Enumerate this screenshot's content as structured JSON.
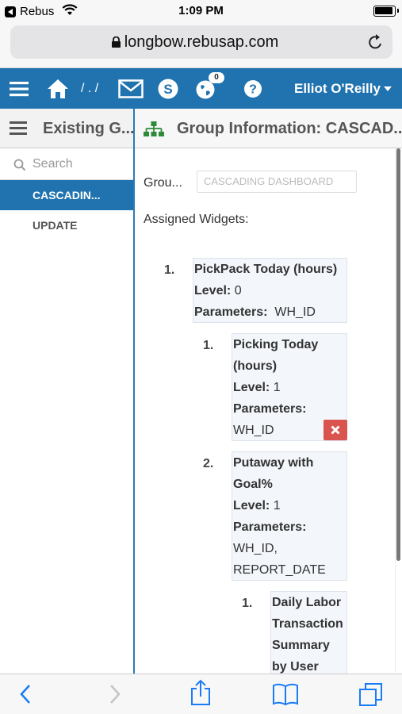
{
  "status_bar": {
    "back_app": "Rebus",
    "time": "1:09 PM"
  },
  "browser": {
    "url": "longbow.rebusap.com"
  },
  "app_header": {
    "breadcrumb": "/ . /",
    "notifications_count": "0",
    "user_name": "Elliot O'Reilly"
  },
  "sidebar": {
    "title": "Existing G...",
    "search_placeholder": "Search",
    "items": [
      {
        "label": "CASCADIN..."
      },
      {
        "label": "UPDATE"
      }
    ]
  },
  "main": {
    "title": "Group Information: CASCAD...",
    "group_label": "Grou...",
    "group_value": "CASCADING DASHBOARD",
    "assigned_label": "Assigned Widgets:",
    "level_label": "Level:",
    "params_label": "Parameters:",
    "widgets": [
      {
        "number": "1.",
        "name": "PickPack Today (hours)",
        "level": "0",
        "parameters": "WH_ID"
      },
      {
        "number": "1.",
        "name_line1": "Picking Today",
        "name_line2": "(hours)",
        "level": "1",
        "parameters": "WH_ID"
      },
      {
        "number": "2.",
        "name_line1": "Putaway with",
        "name_line2": "Goal%",
        "level": "1",
        "parameters_line1": "WH_ID,",
        "parameters_line2": "REPORT_DATE"
      },
      {
        "number": "1.",
        "name_line1": "Daily Labor",
        "name_line2": "Transaction",
        "name_line3": "Summary",
        "name_line4": "by User"
      }
    ]
  },
  "colors": {
    "brand_blue": "#2073af",
    "delete_red": "#d9534f",
    "ios_blue": "#1a7cf5"
  }
}
